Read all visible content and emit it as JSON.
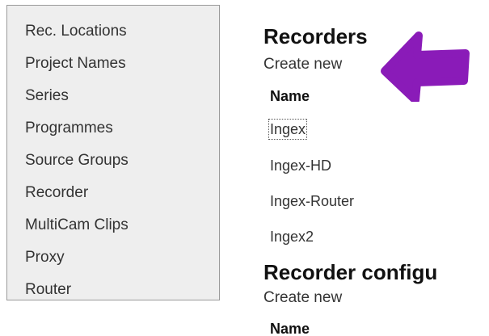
{
  "sidebar": {
    "items": [
      {
        "label": "Rec. Locations"
      },
      {
        "label": "Project Names"
      },
      {
        "label": "Series"
      },
      {
        "label": "Programmes"
      },
      {
        "label": "Source Groups"
      },
      {
        "label": "Recorder"
      },
      {
        "label": "MultiCam Clips"
      },
      {
        "label": "Proxy"
      },
      {
        "label": "Router"
      }
    ]
  },
  "recorders": {
    "title": "Recorders",
    "create_new": "Create new",
    "column_name": "Name",
    "rows": [
      "Ingex",
      "Ingex-HD",
      "Ingex-Router",
      "Ingex2"
    ]
  },
  "recorder_config": {
    "title": "Recorder configu",
    "create_new": "Create new",
    "column_name": "Name"
  },
  "annotation": {
    "arrow_color": "#8a1bb8",
    "icon": "left-arrow-icon"
  }
}
